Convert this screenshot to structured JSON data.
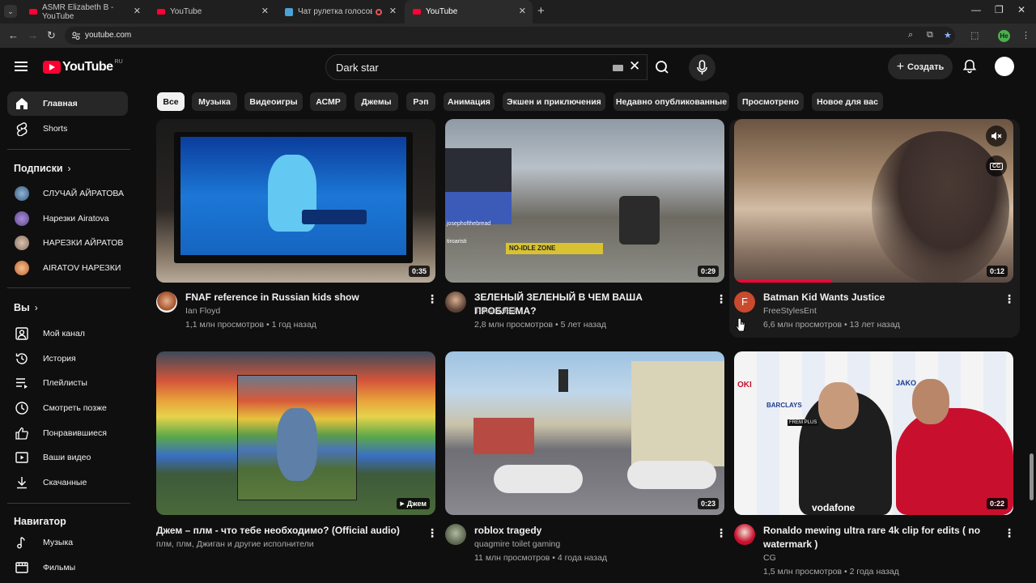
{
  "browser": {
    "tabs": [
      {
        "title": "ASMR Elizabeth B - YouTube",
        "favicon": "youtube-favicon-icon"
      },
      {
        "title": "YouTube",
        "favicon": "youtube-favicon-icon"
      },
      {
        "title": "Чат рулетка голосовая — ",
        "favicon": "chat-favicon-icon"
      },
      {
        "title": "YouTube",
        "favicon": "youtube-favicon-icon"
      }
    ],
    "url": "youtube.com",
    "profile_initials": "He"
  },
  "header": {
    "logo_text": "YouTube",
    "region": "RU",
    "search_query": "Dark star",
    "create_label": "Создать"
  },
  "sidebar": {
    "main": [
      {
        "label": "Главная",
        "icon": "home-icon"
      },
      {
        "label": "Shorts",
        "icon": "shorts-icon"
      }
    ],
    "subs_heading": "Подписки",
    "subscriptions": [
      {
        "label": "СЛУЧАЙ АЙРАТОВА",
        "color": "#3b5a7a"
      },
      {
        "label": "Нарезки Airatova",
        "color": "#5a4a8a"
      },
      {
        "label": "НАРЕЗКИ АЙРАТОВ",
        "color": "#8a7060"
      },
      {
        "label": "AIRATOV НАРЕЗКИ",
        "color": "#c06030"
      }
    ],
    "you_heading": "Вы",
    "you": [
      {
        "label": "Мой канал",
        "icon": "account-icon"
      },
      {
        "label": "История",
        "icon": "history-icon"
      },
      {
        "label": "Плейлисты",
        "icon": "playlists-icon"
      },
      {
        "label": "Смотреть позже",
        "icon": "watch-later-icon"
      },
      {
        "label": "Понравившиеся",
        "icon": "like-icon"
      },
      {
        "label": "Ваши видео",
        "icon": "your-videos-icon"
      },
      {
        "label": "Скачанные",
        "icon": "download-icon"
      }
    ],
    "nav_heading": "Навигатор",
    "navigator": [
      {
        "label": "Музыка",
        "icon": "music-icon"
      },
      {
        "label": "Фильмы",
        "icon": "movies-icon"
      }
    ]
  },
  "chips": [
    "Все",
    "Музыка",
    "Видеоигры",
    "АСМР",
    "Джемы",
    "Рэп",
    "Анимация",
    "Экшен и приключения",
    "Недавно опубликованные",
    "Просмотрено",
    "Новое для вас"
  ],
  "videos": [
    {
      "title": "FNAF reference in Russian kids show",
      "channel": "Ian Floyd",
      "stats": "1,1 млн просмотров • 1 год назад",
      "duration": "0:35"
    },
    {
      "title": "ЗЕЛЕНЫЙ ЗЕЛЕНЫЙ В ЧЕМ ВАША ПРОБЛЕМА?",
      "channel": "Tense1983",
      "stats": "2,8 млн просмотров • 5 лет назад",
      "duration": "0:29",
      "thumb_text": [
        "josephofthebread",
        "tiroaristi",
        "NO-IDLE ZONE"
      ]
    },
    {
      "title": "Batman Kid Wants Justice",
      "channel": "FreeStylesEnt",
      "stats": "6,6 млн просмотров • 13 лет назад",
      "duration": "0:12",
      "avatar_letter": "F",
      "progress": 0.35
    },
    {
      "title": "Джем – плм - что тебе необходимо? (Official audio)",
      "channel": "плм, плм, Джиган и другие исполнители",
      "stats": "",
      "badge": "Джем"
    },
    {
      "title": "roblox tragedy",
      "channel": "quagmire toilet gaming",
      "stats": "11 млн просмотров • 4 года назад",
      "duration": "0:23"
    },
    {
      "title": "Ronaldo mewing ultra rare 4k clip for edits ( no watermark )",
      "channel": "CG",
      "stats": "1,5 млн просмотров • 2 года назад",
      "duration": "0:22",
      "thumb_text": [
        "OKI",
        "JAKO",
        "BARCLAYS",
        "FREM PLUS",
        "vodafone"
      ]
    }
  ]
}
